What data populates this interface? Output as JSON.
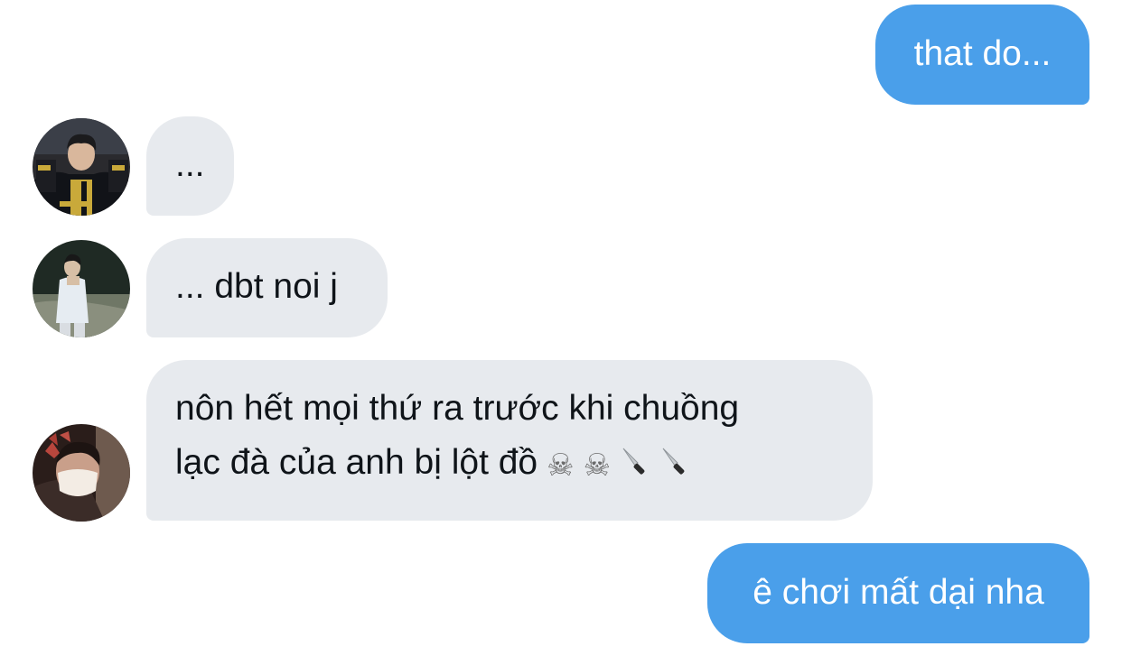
{
  "conversation": {
    "messages": [
      {
        "sender": "me",
        "text": "that do..."
      },
      {
        "sender": "user1",
        "avatar": "avatar-photo-jersey",
        "text": "..."
      },
      {
        "sender": "user2",
        "avatar": "avatar-photo-standing",
        "text": "... dbt noi j"
      },
      {
        "sender": "user3",
        "avatar": "avatar-photo-masked",
        "line1": "nôn hết mọi thứ ra trước khi chuồng",
        "line2": "lạc đà của anh bị lột đồ",
        "emojis": [
          {
            "name": "skull-crossbones-icon",
            "glyph": "☠"
          },
          {
            "name": "skull-crossbones-icon",
            "glyph": "☠"
          },
          {
            "name": "knife-icon",
            "glyph": "🔪"
          },
          {
            "name": "knife-icon",
            "glyph": "🔪"
          }
        ]
      },
      {
        "sender": "me",
        "text": "ê chơi mất dại nha"
      }
    ]
  },
  "colors": {
    "outgoing_bubble": "#4a9fea",
    "incoming_bubble": "#e7eaee",
    "incoming_text": "#0f1419",
    "outgoing_text": "#ffffff"
  }
}
